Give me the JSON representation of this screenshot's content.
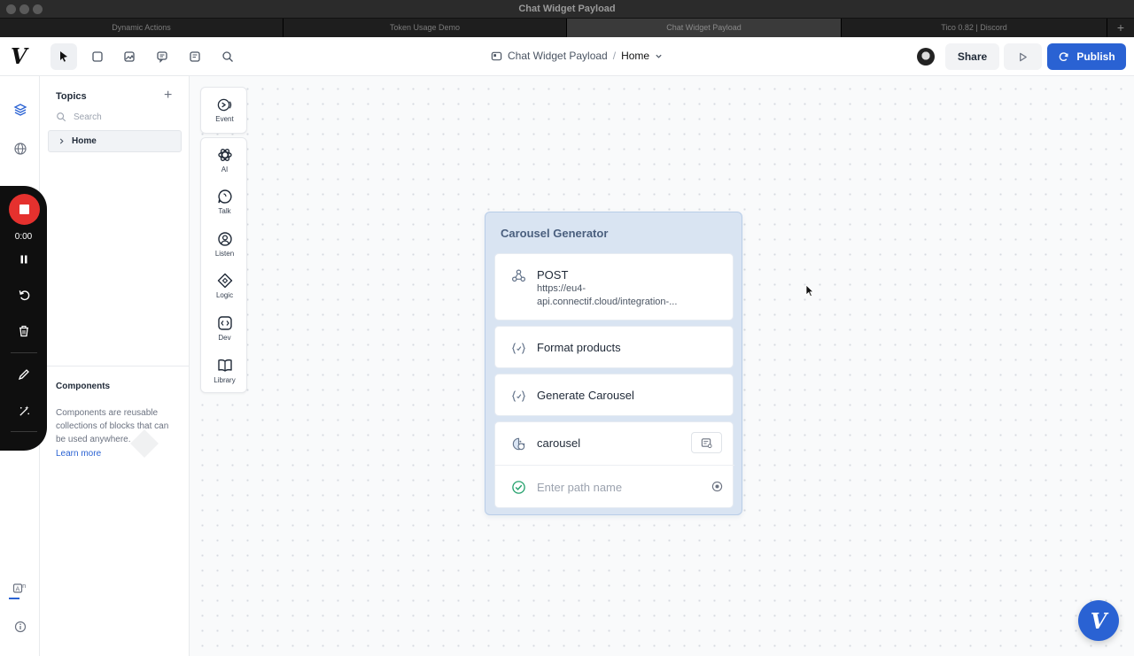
{
  "window": {
    "title": "Chat Widget Payload",
    "tabs": [
      {
        "label": "Dynamic Actions",
        "active": false
      },
      {
        "label": "Token Usage Demo",
        "active": false
      },
      {
        "label": "Chat Widget Payload",
        "active": true
      },
      {
        "label": "Tico 0.82 | Discord",
        "active": false
      }
    ],
    "new_tab_icon": "plus-icon"
  },
  "header": {
    "logo": "V",
    "tools": [
      "pointer-icon",
      "square-icon",
      "image-icon",
      "comment-icon",
      "notes-icon",
      "search-icon"
    ],
    "breadcrumb": {
      "project": "Chat Widget Payload",
      "separator": "/",
      "page": "Home"
    },
    "share_label": "Share",
    "publish_label": "Publish",
    "accent_color": "#2a62d3"
  },
  "recording": {
    "time": "0:00",
    "record_color": "#e5312e"
  },
  "topics": {
    "title": "Topics",
    "search_placeholder": "Search",
    "items": [
      {
        "label": "Home"
      }
    ]
  },
  "components": {
    "title": "Components",
    "description": "Components are reusable collections of blocks that can be used anywhere.",
    "link": "Learn more"
  },
  "palette": {
    "event": {
      "label": "Event"
    },
    "items": [
      {
        "label": "AI",
        "icon": "openai-icon"
      },
      {
        "label": "Talk",
        "icon": "chat-bubble-icon"
      },
      {
        "label": "Listen",
        "icon": "user-circle-icon"
      },
      {
        "label": "Logic",
        "icon": "diamond-icon"
      },
      {
        "label": "Dev",
        "icon": "code-icon"
      },
      {
        "label": "Library",
        "icon": "book-icon"
      }
    ]
  },
  "node": {
    "title": "Carousel Generator",
    "steps": [
      {
        "title": "POST",
        "subtitle": "https://eu4-api.connectif.cloud/integration-...",
        "icon": "webhook-icon"
      },
      {
        "title": "Format products",
        "icon": "function-icon"
      },
      {
        "title": "Generate Carousel",
        "icon": "function-icon"
      },
      {
        "title": "carousel",
        "icon": "carousel-icon",
        "path_placeholder": "Enter path name"
      }
    ]
  }
}
